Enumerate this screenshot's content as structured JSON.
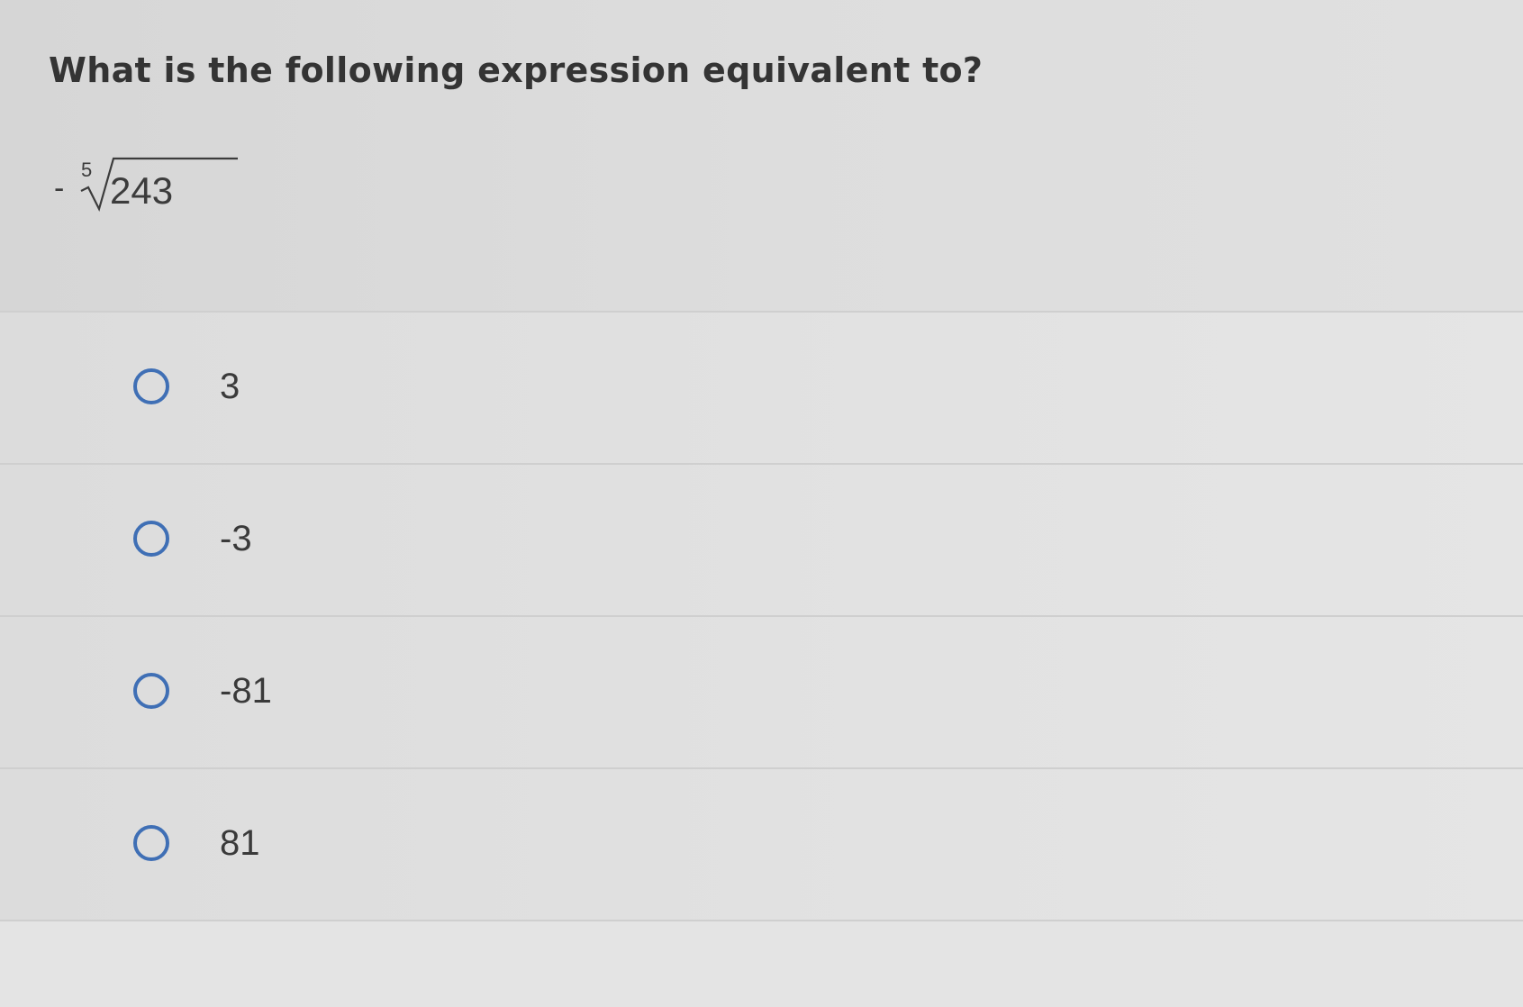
{
  "question": {
    "prompt": "What is the following expression equivalent to?",
    "expression": {
      "sign": "-",
      "root_index": "5",
      "radicand": "243"
    }
  },
  "options": [
    {
      "label": "3"
    },
    {
      "label": "-3"
    },
    {
      "label": "-81"
    },
    {
      "label": "81"
    }
  ],
  "colors": {
    "radio_border": "#3f6fb5",
    "background": "#dedede",
    "text": "#3a3a3a"
  }
}
